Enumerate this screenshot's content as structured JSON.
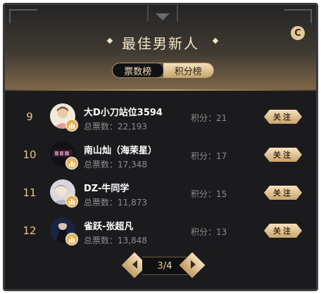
{
  "header": {
    "title": "最佳男新人",
    "close_icon": "C"
  },
  "tabs": [
    {
      "label": "票数榜",
      "active": true
    },
    {
      "label": "积分榜",
      "active": false
    }
  ],
  "rows": [
    {
      "rank": "9",
      "name": "大D小刀站位3594",
      "votes": "总票数：22,193",
      "score": "积分：21",
      "follow": "关注",
      "avatar_color": "#e8d6c4"
    },
    {
      "rank": "10",
      "name": "南山灿（海茉星）",
      "votes": "总票数：17,348",
      "score": "积分：17",
      "follow": "关注",
      "avatar_color": "#2a2030"
    },
    {
      "rank": "11",
      "name": "DZ-牛同学",
      "votes": "总票数：11,873",
      "score": "积分：15",
      "follow": "关注",
      "avatar_color": "#c9c4cf"
    },
    {
      "rank": "12",
      "name": "雀跃-张超凡",
      "votes": "总票数：13,848",
      "score": "积分：13",
      "follow": "关注",
      "avatar_color": "#1f2a4a"
    }
  ],
  "pager": {
    "current": "3",
    "separator": "/4"
  },
  "colors": {
    "accent_gold": "#e6c58f",
    "panel_bg": "#1b1b1e"
  }
}
